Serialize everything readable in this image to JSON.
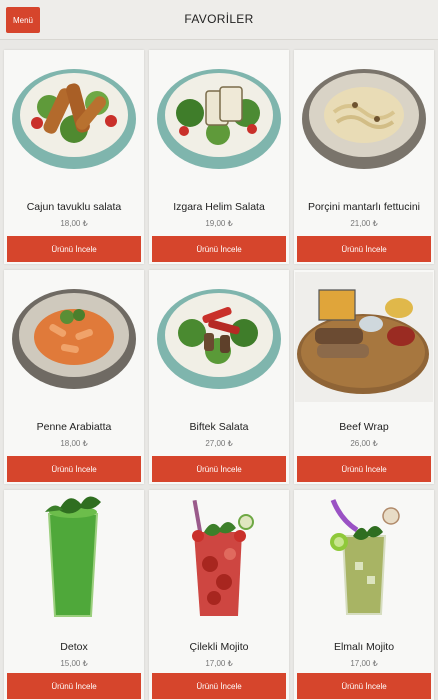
{
  "header": {
    "menu_label": "Menü",
    "title": "FAVORİLER"
  },
  "products": [
    {
      "name": "Cajun tavuklu salata",
      "price": "18,00 ₺",
      "button": "Ürünü İncele",
      "image": "bowl-salad-chicken"
    },
    {
      "name": "Izgara Helim Salata",
      "price": "19,00 ₺",
      "button": "Ürünü İncele",
      "image": "bowl-salad-halloumi"
    },
    {
      "name": "Porçini mantarlı fettucini",
      "price": "21,00 ₺",
      "button": "Ürünü İncele",
      "image": "plate-pasta-fettuccine"
    },
    {
      "name": "Penne Arabiatta",
      "price": "18,00 ₺",
      "button": "Ürünü İncele",
      "image": "plate-pasta-penne"
    },
    {
      "name": "Biftek Salata",
      "price": "27,00 ₺",
      "button": "Ürünü İncele",
      "image": "bowl-salad-steak"
    },
    {
      "name": "Beef Wrap",
      "price": "26,00 ₺",
      "button": "Ürünü İncele",
      "image": "board-wrap-fries"
    },
    {
      "name": "Detox",
      "price": "15,00 ₺",
      "button": "Ürünü İncele",
      "image": "glass-green-drink"
    },
    {
      "name": "Çilekli Mojito",
      "price": "17,00 ₺",
      "button": "Ürünü İncele",
      "image": "glass-strawberry-mojito"
    },
    {
      "name": "Elmalı Mojito",
      "price": "17,00 ₺",
      "button": "Ürünü İncele",
      "image": "glass-apple-mojito"
    }
  ],
  "colors": {
    "accent": "#d6452c",
    "background": "#e9e8e5",
    "card": "#f8f8f6"
  }
}
